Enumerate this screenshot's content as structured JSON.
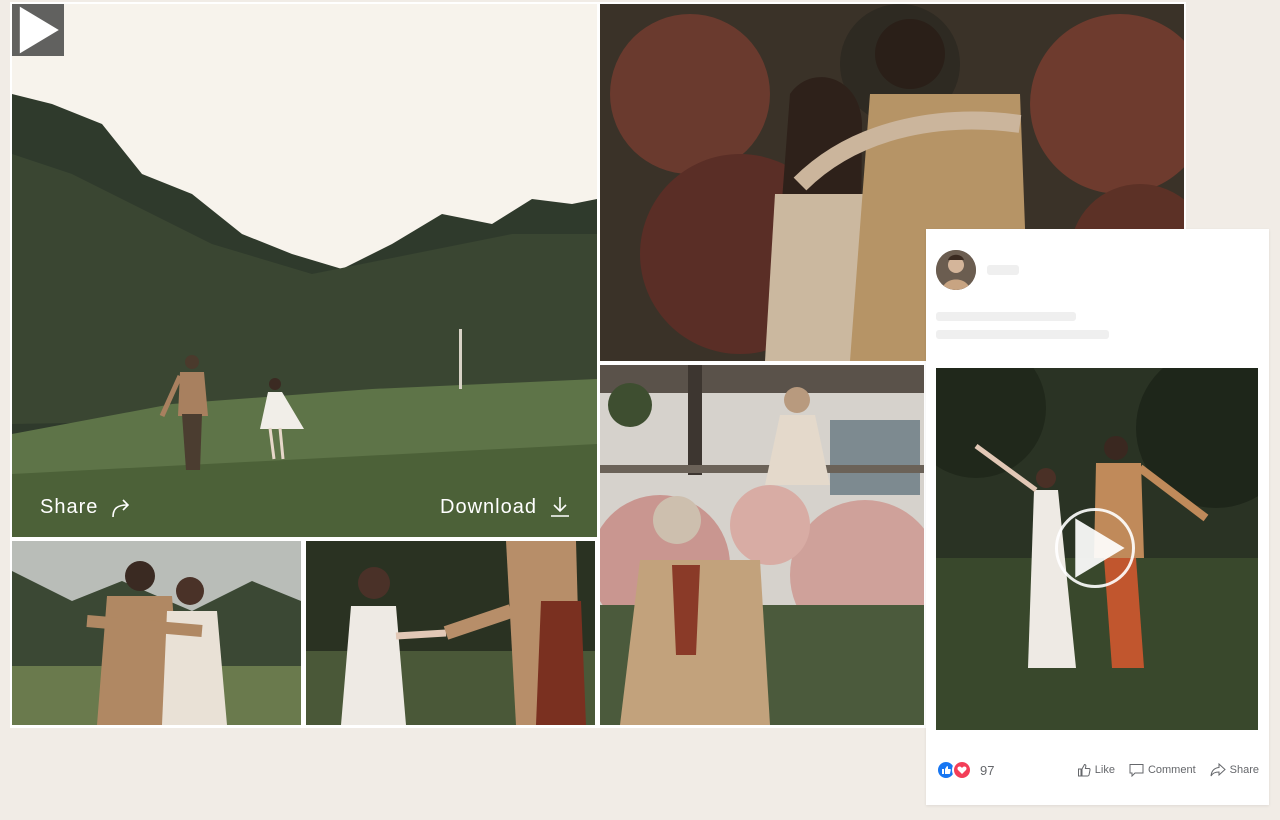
{
  "gallery": {
    "hero": {
      "play_icon": "play-icon",
      "share_label": "Share",
      "share_icon": "share-arrow-icon",
      "download_label": "Download",
      "download_icon": "download-icon"
    }
  },
  "post": {
    "reaction_count": "97",
    "reaction_icons": [
      "like-icon",
      "love-icon"
    ],
    "actions": {
      "like": "Like",
      "comment": "Comment",
      "share": "Share"
    }
  },
  "colors": {
    "page_background": "#f1ece6",
    "like_blue": "#1877f2",
    "love_red": "#f33e58"
  }
}
